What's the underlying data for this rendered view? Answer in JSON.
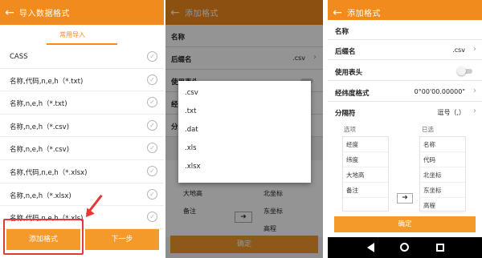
{
  "colors": {
    "accent": "#f28b1e",
    "button": "#f39a2a",
    "highlight": "#e53935"
  },
  "panel1": {
    "title": "导入数据格式",
    "tab": "常用导入",
    "items": [
      "CASS",
      "名称,代码,n,e,h（*.txt)",
      "名称,n,e,h（*.txt)",
      "名称,n,e,h（*.csv)",
      "名称,n,e,h（*.csv)",
      "名称,代码,n,e,h（*.xlsx)",
      "名称,n,e,h（*.xlsx)",
      "名称,代码,n,e,h（*.xls)"
    ],
    "add_button": "添加格式",
    "next_button": "下一步"
  },
  "panel2": {
    "title": "添加格式",
    "name_label": "名称",
    "suffix_label": "后缀名",
    "suffix_value": ".csv",
    "header_label": "使用表头",
    "partial_label_1": "经",
    "partial_label_2": "分",
    "dialog_options": [
      ".csv",
      ".txt",
      ".dat",
      ".xls",
      ".xlsx"
    ],
    "list_left": [
      "大地高",
      "备注"
    ],
    "list_right": [
      "北坐标",
      "东坐标",
      "高程"
    ],
    "confirm": "确定"
  },
  "panel3": {
    "title": "添加格式",
    "name_label": "名称",
    "suffix_label": "后缀名",
    "suffix_value": ".csv",
    "header_label": "使用表头",
    "latlon_label": "经纬度格式",
    "latlon_value": "0°00'00.00000\"",
    "sep_label": "分隔符",
    "sep_value": "逗号（,）",
    "col_options": "选项",
    "col_selected": "已选",
    "options": [
      "经度",
      "纬度",
      "大地高",
      "备注"
    ],
    "selected": [
      "名称",
      "代码",
      "北坐标",
      "东坐标",
      "高程"
    ],
    "confirm": "确定"
  }
}
